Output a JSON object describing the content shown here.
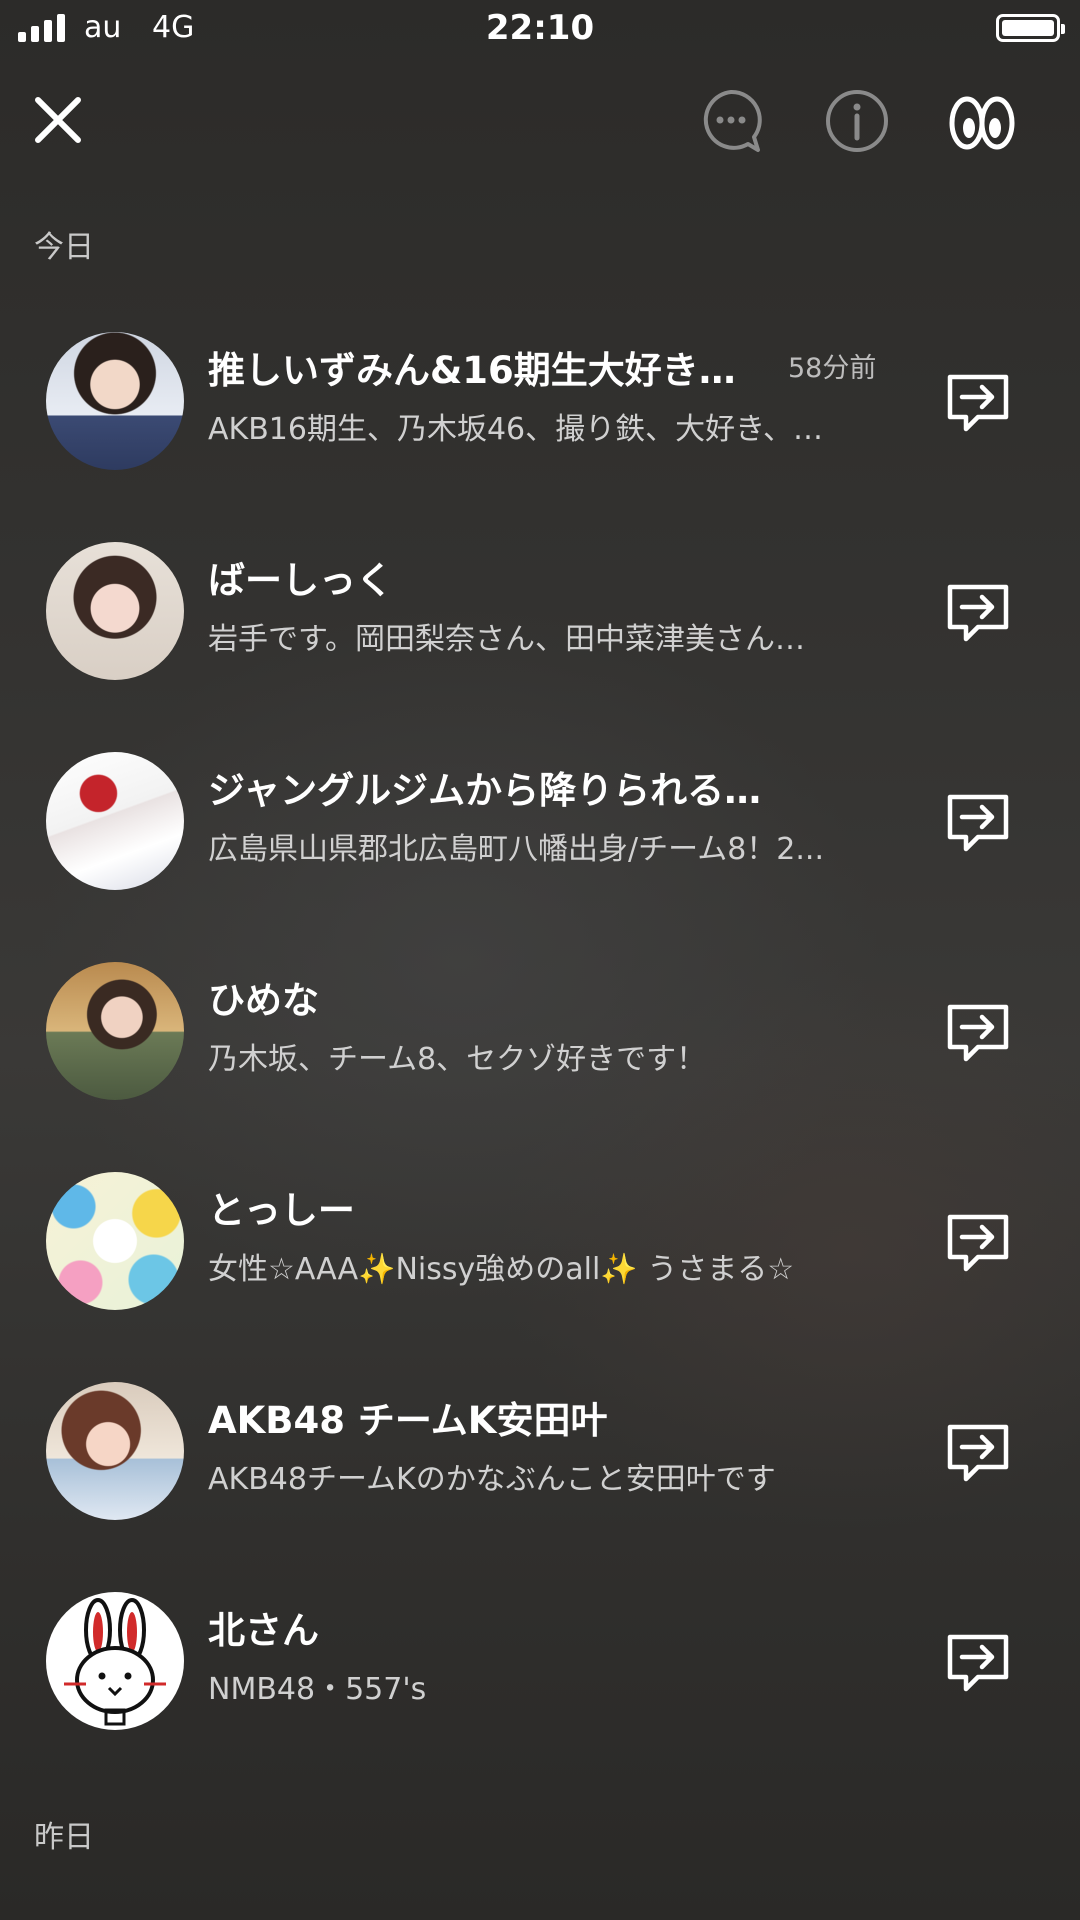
{
  "status_bar": {
    "carrier": "au",
    "network": "4G",
    "time": "22:10"
  },
  "sections": {
    "today": "今日",
    "yesterday": "昨日"
  },
  "friends": [
    {
      "name": "推しいずみん&16期生大好き…",
      "time": "58分前",
      "desc": "AKB16期生、乃木坂46、撮り鉄、大好き、…"
    },
    {
      "name": "ばーしっく",
      "time": "",
      "desc": "岩手です。岡田梨奈さん、田中菜津美さん…"
    },
    {
      "name": "ジャングルジムから降りられる男子",
      "time": "",
      "desc": "広島県山県郡北広島町八幡出身/チーム8！2..."
    },
    {
      "name": "ひめな",
      "time": "",
      "desc": "乃木坂、チーム8、セクゾ好きです！"
    },
    {
      "name": "とっしー",
      "time": "",
      "desc": "女性☆AAA✨Nissy強めのall✨ うさまる☆"
    },
    {
      "name": "AKB48 チームK安田叶",
      "time": "",
      "desc": "AKB48チームKのかなぶんこと安田叶です"
    },
    {
      "name": "北さん",
      "time": "",
      "desc": "NMB48・557's"
    }
  ],
  "icons": {
    "close": "close-icon",
    "chat": "chat-bubble-icon",
    "info": "info-icon",
    "footprint": "footprints-icon",
    "share": "share-arrow-icon"
  },
  "colors": {
    "background": "#33322f",
    "text": "#ffffff",
    "secondary_text": "#d0d0d0"
  }
}
